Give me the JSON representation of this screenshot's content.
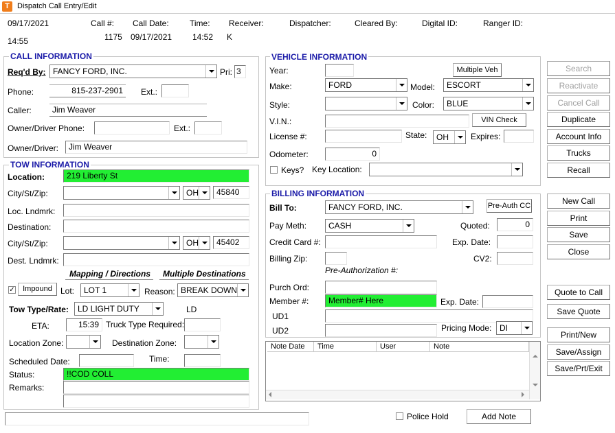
{
  "window": {
    "title": "Dispatch Call Entry/Edit",
    "icon_letter": "T"
  },
  "header": {
    "date": "09/17/2021",
    "time_now": "14:55",
    "call_label": "Call #:",
    "call_value": "1175",
    "call_date_label": "Call Date:",
    "call_date_value": "09/17/2021",
    "time_label": "Time:",
    "time_value": "14:52",
    "receiver_label": "Receiver:",
    "receiver_value": "K",
    "dispatcher_label": "Dispatcher:",
    "cleared_by_label": "Cleared By:",
    "digital_id_label": "Digital ID:",
    "ranger_id_label": "Ranger ID:"
  },
  "call_info": {
    "title": "CALL INFORMATION",
    "reqd_by_label": "Req'd By:",
    "reqd_by_value": "FANCY FORD, INC.",
    "pri_label": "Pri:",
    "pri_value": "3",
    "phone_label": "Phone:",
    "phone_value": "815-237-2901",
    "ext_label": "Ext.:",
    "caller_label": "Caller:",
    "caller_value": "Jim Weaver",
    "owner_phone_label": "Owner/Driver Phone:",
    "owner_ext_label": "Ext.:",
    "owner_label": "Owner/Driver:",
    "owner_value": "Jim Weaver"
  },
  "tow_info": {
    "title": "TOW INFORMATION",
    "location_label": "Location:",
    "location_value": "219 Liberty St",
    "csz_label": "City/St/Zip:",
    "state1": "OH",
    "zip1": "45840",
    "loc_landmark_label": "Loc. Lndmrk:",
    "destination_label": "Destination:",
    "csz2_label": "City/St/Zip:",
    "state2": "OH",
    "zip2": "45402",
    "dest_landmark_label": "Dest. Lndmrk:",
    "mapping_link": "Mapping / Directions",
    "multiple_dest_link": "Multiple Destinations",
    "impound_check": "✓",
    "impound_button": "Impound",
    "lot_label": "Lot:",
    "lot_value": "LOT 1",
    "reason_label": "Reason:",
    "reason_value": "BREAK DOWN",
    "tow_type_label": "Tow Type/Rate:",
    "tow_type_value": "LD LIGHT DUTY",
    "tow_type_code": "LD",
    "eta_label": "ETA:",
    "eta_value": "15:39",
    "truck_type_label": "Truck Type Required:",
    "location_zone_label": "Location Zone:",
    "destination_zone_label": "Destination Zone:",
    "scheduled_date_label": "Scheduled Date:",
    "sched_time_label": "Time:",
    "status_label": "Status:",
    "status_value": "!!COD COLL",
    "remarks_label": "Remarks:"
  },
  "vehicle_info": {
    "title": "VEHICLE INFORMATION",
    "year_label": "Year:",
    "multiple_veh_button": "Multiple Veh",
    "make_label": "Make:",
    "make_value": "FORD",
    "model_label": "Model:",
    "model_value": "ESCORT",
    "style_label": "Style:",
    "color_label": "Color:",
    "color_value": "BLUE",
    "vin_label": "V.I.N.:",
    "vin_check_button": "VIN Check",
    "license_label": "License #:",
    "state_label": "State:",
    "state_value": "OH",
    "expires_label": "Expires:",
    "odometer_label": "Odometer:",
    "odometer_value": "0",
    "keys_label": "Keys?",
    "key_location_label": "Key Location:"
  },
  "billing_info": {
    "title": "BILLING INFORMATION",
    "bill_to_label": "Bill To:",
    "bill_to_value": "FANCY FORD, INC.",
    "preauth_button": "Pre-Auth CC",
    "pay_meth_label": "Pay Meth:",
    "pay_meth_value": "CASH",
    "quoted_label": "Quoted:",
    "quoted_value": "0",
    "credit_card_label": "Credit Card #:",
    "exp_date_label": "Exp. Date:",
    "billing_zip_label": "Billing Zip:",
    "cv2_label": "CV2:",
    "preauth_label": "Pre-Authorization #:",
    "purch_ord_label": "Purch Ord:",
    "member_label": "Member #:",
    "member_value": "Member# Here",
    "member_exp_label": "Exp. Date:",
    "ud1_label": "UD1",
    "ud2_label": "UD2",
    "pricing_mode_label": "Pricing Mode:",
    "pricing_mode_value": "DI"
  },
  "notes_table": {
    "columns": [
      "Note Date",
      "Time",
      "User",
      "Note"
    ]
  },
  "side_buttons": {
    "search": "Search",
    "reactivate": "Reactivate",
    "cancel_call": "Cancel Call",
    "duplicate": "Duplicate",
    "account_info": "Account Info",
    "trucks": "Trucks",
    "recall": "Recall",
    "new_call": "New Call",
    "print": "Print",
    "save": "Save",
    "close": "Close",
    "quote_to_call": "Quote to Call",
    "save_quote": "Save Quote",
    "print_new": "Print/New",
    "save_assign": "Save/Assign",
    "save_prt_exit": "Save/Prt/Exit"
  },
  "footer": {
    "police_hold_label": "Police Hold",
    "add_note_button": "Add Note"
  }
}
